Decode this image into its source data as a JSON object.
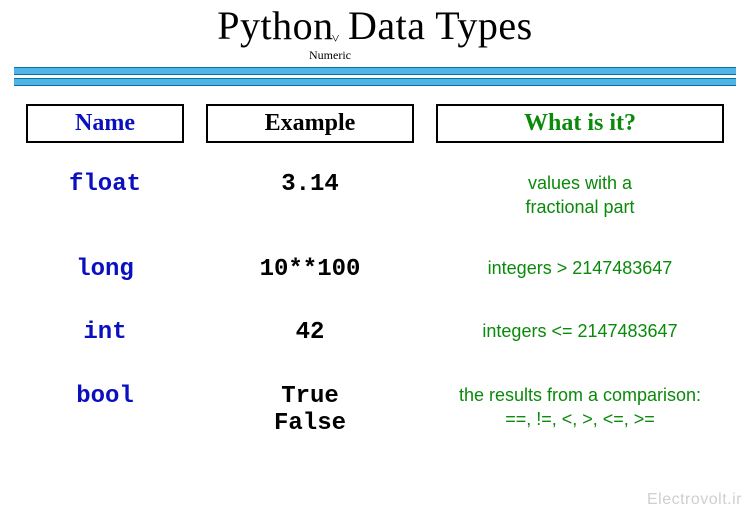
{
  "title_part1": "Python",
  "title_caret": "˅",
  "title_part2": " Data Types",
  "subtitle": "Numeric",
  "headers": {
    "name": "Name",
    "example": "Example",
    "whatisit": "What is it?"
  },
  "rows": [
    {
      "name": "float",
      "example": "3.14",
      "what": "values with a\nfractional part"
    },
    {
      "name": "long",
      "example": "10**100",
      "what": "integers > 2147483647"
    },
    {
      "name": "int",
      "example": "42",
      "what": "integers <= 2147483647"
    },
    {
      "name": "bool",
      "example": "True\nFalse",
      "what": "the results from a comparison:\n==,  !=, <, >, <=, >="
    }
  ],
  "watermark": "Electrovolt.ir"
}
